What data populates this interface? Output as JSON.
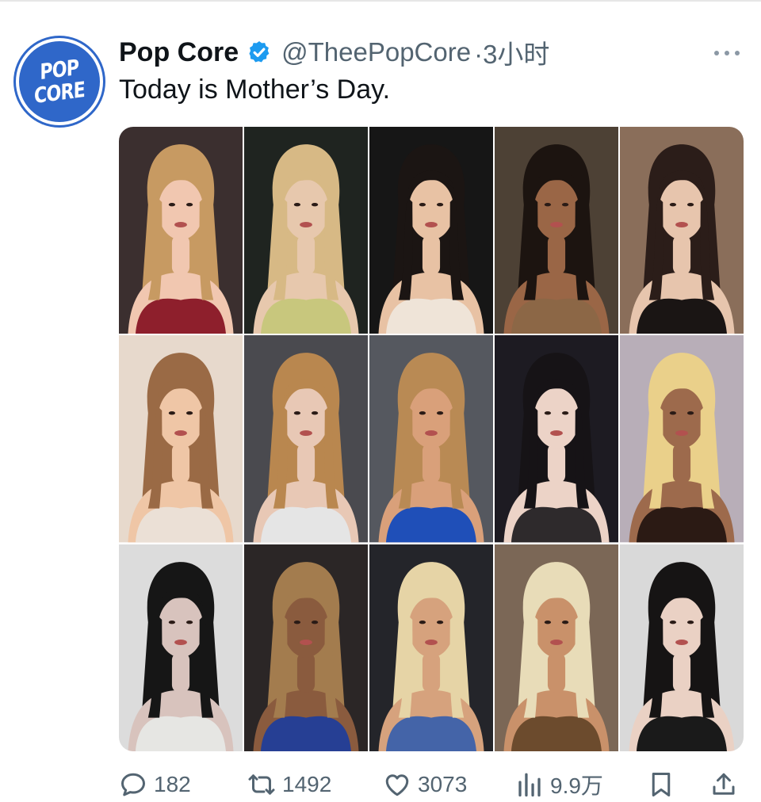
{
  "tweet": {
    "avatar": {
      "line1": "POP",
      "line2": "CORE",
      "color": "#2f67c9"
    },
    "display_name": "Pop Core",
    "verified": true,
    "handle": "@TheePopCore",
    "timestamp": "·3小时",
    "text": "Today is Mother’s Day.",
    "more_icon": "more-horizontal-icon",
    "media": {
      "photo_count": 15,
      "tiles": [
        {
          "bg": "#3b2f2f",
          "hair": "#c79a62",
          "skin": "#f1c7b0",
          "outfit": "#8e1f2c"
        },
        {
          "bg": "#1f2420",
          "hair": "#d7b985",
          "skin": "#e7c8ad",
          "outfit": "#c8c77d"
        },
        {
          "bg": "#161616",
          "hair": "#1b1513",
          "skin": "#e8c2a4",
          "outfit": "#efe4d8"
        },
        {
          "bg": "#4d4135",
          "hair": "#1c1410",
          "skin": "#9a6646",
          "outfit": "#8c6746"
        },
        {
          "bg": "#8a6e5a",
          "hair": "#2b1d19",
          "skin": "#e7c5ad",
          "outfit": "#1a1514"
        },
        {
          "bg": "#e7d9cc",
          "hair": "#9a6a45",
          "skin": "#efc6a6",
          "outfit": "#ebe0d6"
        },
        {
          "bg": "#4a4a4f",
          "hair": "#b9874f",
          "skin": "#e8c8b5",
          "outfit": "#e5e5e5"
        },
        {
          "bg": "#55585f",
          "hair": "#b98a54",
          "skin": "#d9a07a",
          "outfit": "#1f4fb8"
        },
        {
          "bg": "#1d1b22",
          "hair": "#161316",
          "skin": "#ecd3c7",
          "outfit": "#2e2a2c"
        },
        {
          "bg": "#b8aeb8",
          "hair": "#ead08a",
          "skin": "#9d6a4c",
          "outfit": "#2b1a14"
        },
        {
          "bg": "#dcdcdc",
          "hair": "#161616",
          "skin": "#d8c3bd",
          "outfit": "#e6e6e3"
        },
        {
          "bg": "#2b2626",
          "hair": "#a37c4e",
          "skin": "#8a5b3e",
          "outfit": "#263f94"
        },
        {
          "bg": "#24252a",
          "hair": "#e6d4a6",
          "skin": "#d6a27d",
          "outfit": "#4464a8"
        },
        {
          "bg": "#7b6756",
          "hair": "#e8dcb8",
          "skin": "#c9916a",
          "outfit": "#6c4b2d"
        },
        {
          "bg": "#d9d9d9",
          "hair": "#161414",
          "skin": "#ead1c4",
          "outfit": "#1a1a1a"
        }
      ]
    },
    "actions": [
      {
        "name": "reply",
        "icon": "reply-icon",
        "count": "182"
      },
      {
        "name": "retweet",
        "icon": "retweet-icon",
        "count": "1492"
      },
      {
        "name": "like",
        "icon": "heart-icon",
        "count": "3073"
      },
      {
        "name": "views",
        "icon": "views-chart-icon",
        "count": "9.9万"
      },
      {
        "name": "bookmark",
        "icon": "bookmark-icon",
        "count": ""
      },
      {
        "name": "share",
        "icon": "share-icon",
        "count": ""
      }
    ],
    "colors": {
      "text": "#0f1419",
      "secondary": "#536471",
      "verified": "#1d9bf0"
    }
  }
}
